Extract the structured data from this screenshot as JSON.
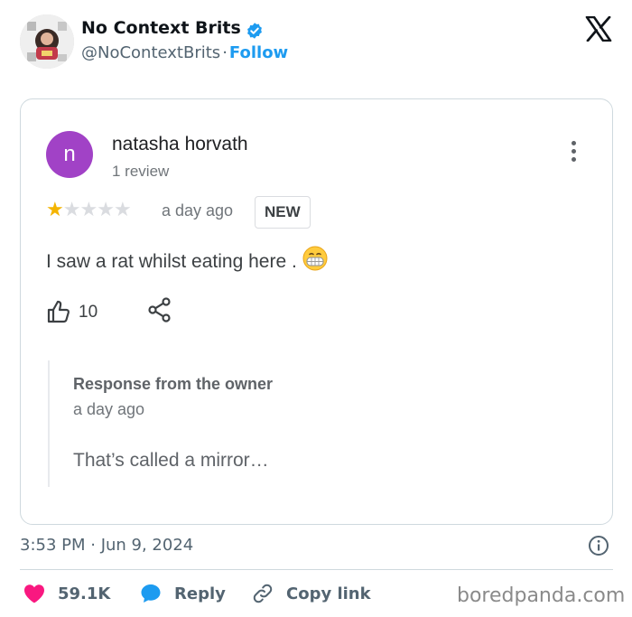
{
  "tweet": {
    "author_name": "No Context Brits",
    "handle": "@NoContextBrits",
    "separator": "·",
    "follow_label": "Follow",
    "timestamp": "3:53 PM · Jun 9, 2024",
    "likes": "59.1K",
    "reply_label": "Reply",
    "copy_link_label": "Copy link"
  },
  "review": {
    "avatar_letter": "n",
    "reviewer_name": "natasha horvath",
    "review_count": "1 review",
    "rating": 1,
    "max_rating": 5,
    "time": "a day ago",
    "badge": "NEW",
    "text": "I saw a rat whilst eating here .",
    "likes": "10",
    "owner_response_title": "Response from the owner",
    "owner_response_time": "a day ago",
    "owner_response_text": "That’s called a mirror…"
  },
  "watermark": "boredpanda.com",
  "colors": {
    "verified_blue": "#1d9bf0",
    "like_pink": "#f91880",
    "reviewer_avatar": "#a142c6",
    "star_filled": "#f4b400"
  },
  "icons": [
    "verified-badge-icon",
    "x-logo-icon",
    "more-vert-icon",
    "thumbs-up-icon",
    "share-icon",
    "info-icon",
    "heart-icon",
    "reply-bubble-icon",
    "link-icon",
    "grimace-mask-emoji"
  ]
}
